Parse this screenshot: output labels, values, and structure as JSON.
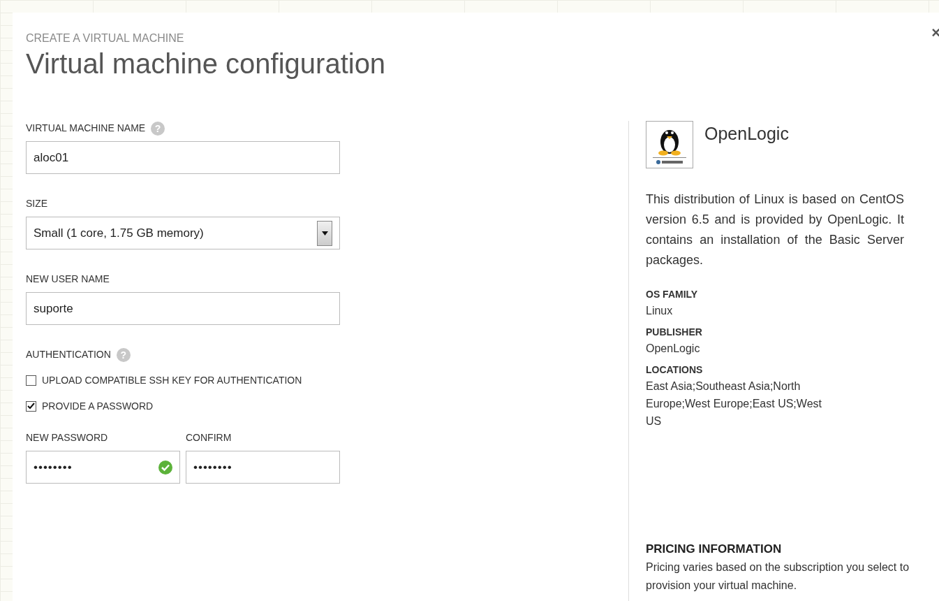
{
  "dialog": {
    "subtitle": "CREATE A VIRTUAL MACHINE",
    "title": "Virtual machine configuration",
    "close": "×"
  },
  "form": {
    "vm_name": {
      "label": "VIRTUAL MACHINE NAME",
      "help": "?",
      "value": "aloc01"
    },
    "size": {
      "label": "SIZE",
      "value": "Small (1 core, 1.75 GB memory)"
    },
    "user_name": {
      "label": "NEW USER NAME",
      "value": "suporte"
    },
    "authentication": {
      "label": "AUTHENTICATION",
      "help": "?",
      "options": [
        {
          "label": "UPLOAD COMPATIBLE SSH KEY FOR AUTHENTICATION",
          "checked": false
        },
        {
          "label": "PROVIDE A PASSWORD",
          "checked": true
        }
      ]
    },
    "password": {
      "label": "NEW PASSWORD",
      "value": "••••••••",
      "valid": true
    },
    "confirm": {
      "label": "CONFIRM",
      "value": "••••••••"
    }
  },
  "image": {
    "name": "OpenLogic",
    "description": "This distribution of Linux is based on CentOS version 6.5 and is provided by OpenLogic. It contains an installation of the Basic Server packages.",
    "details": [
      {
        "label": "OS FAMILY",
        "value": "Linux"
      },
      {
        "label": "PUBLISHER",
        "value": "OpenLogic"
      },
      {
        "label": "LOCATIONS",
        "value": "East Asia;Southeast Asia;North Europe;West Europe;East US;West US"
      }
    ],
    "pricing": {
      "label": "PRICING INFORMATION",
      "text": "Pricing varies based on the subscription you select to provision your virtual machine."
    }
  }
}
